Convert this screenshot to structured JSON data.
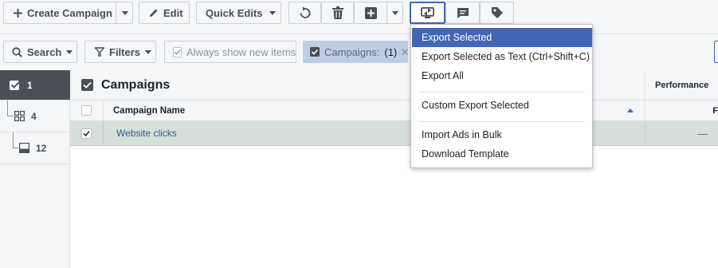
{
  "toolbar": {
    "create_campaign_label": "Create Campaign",
    "edit_label": "Edit",
    "quick_edits_label": "Quick Edits"
  },
  "filterbar": {
    "search_label": "Search",
    "filters_label": "Filters",
    "always_show_label": "Always show new items",
    "chip_label": "Campaigns:",
    "chip_count": "(1)"
  },
  "nav": {
    "campaigns_count": "1",
    "adsets_count": "4",
    "ads_count": "12"
  },
  "grid": {
    "title": "Campaigns",
    "col_campaign_name": "Campaign Name",
    "col_performance": "Performance",
    "perf_partial": "F",
    "rows": [
      {
        "name": "Website clicks",
        "performance": "—"
      }
    ]
  },
  "export_menu": {
    "items": [
      "Export Selected",
      "Export Selected as Text (Ctrl+Shift+C)",
      "Export All",
      "Custom Export Selected",
      "Import Ads in Bulk",
      "Download Template"
    ]
  },
  "colors": {
    "accent": "#4267b2",
    "selected_row": "#d6dfd9",
    "nav_active": "#4b4f56"
  }
}
